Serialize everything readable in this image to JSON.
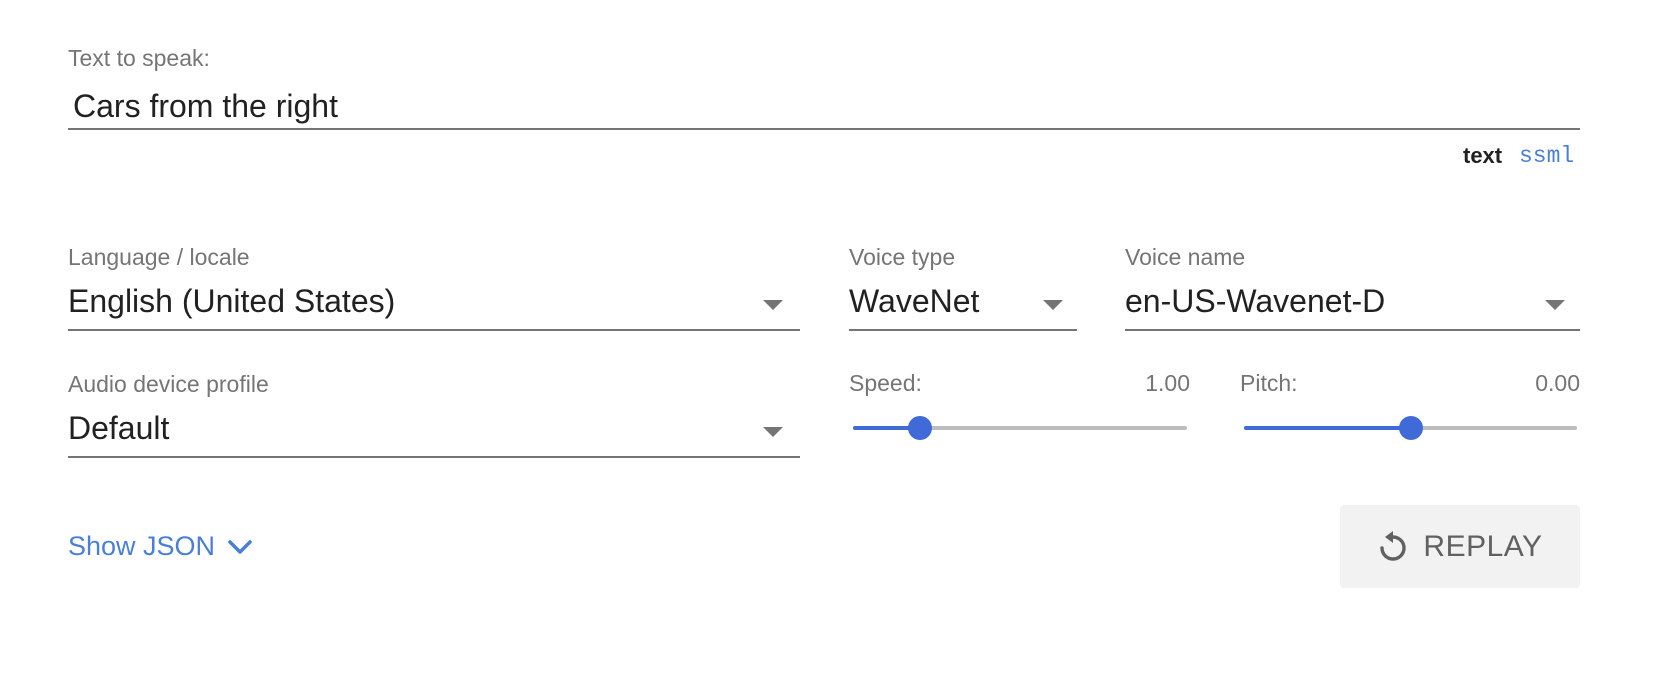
{
  "text_input": {
    "label": "Text to speak:",
    "value": "Cars from the right"
  },
  "input_mode": {
    "text_label": "text",
    "ssml_label": "ssml",
    "selected": "text"
  },
  "language": {
    "label": "Language / locale",
    "value": "English (United States)"
  },
  "voice_type": {
    "label": "Voice type",
    "value": "WaveNet"
  },
  "voice_name": {
    "label": "Voice name",
    "value": "en-US-Wavenet-D"
  },
  "audio_profile": {
    "label": "Audio device profile",
    "value": "Default"
  },
  "speed": {
    "label": "Speed:",
    "value_text": "1.00",
    "fraction": 0.2
  },
  "pitch": {
    "label": "Pitch:",
    "value_text": "0.00",
    "fraction": 0.5
  },
  "show_json": {
    "label": "Show JSON",
    "icon": "chevron-down-icon"
  },
  "replay": {
    "label": "REPLAY",
    "icon": "replay-icon"
  },
  "colors": {
    "accent": "#3f6ad8",
    "link": "#4a7fd6",
    "label": "#757575",
    "text": "#212121",
    "button_bg": "#f2f2f2"
  }
}
